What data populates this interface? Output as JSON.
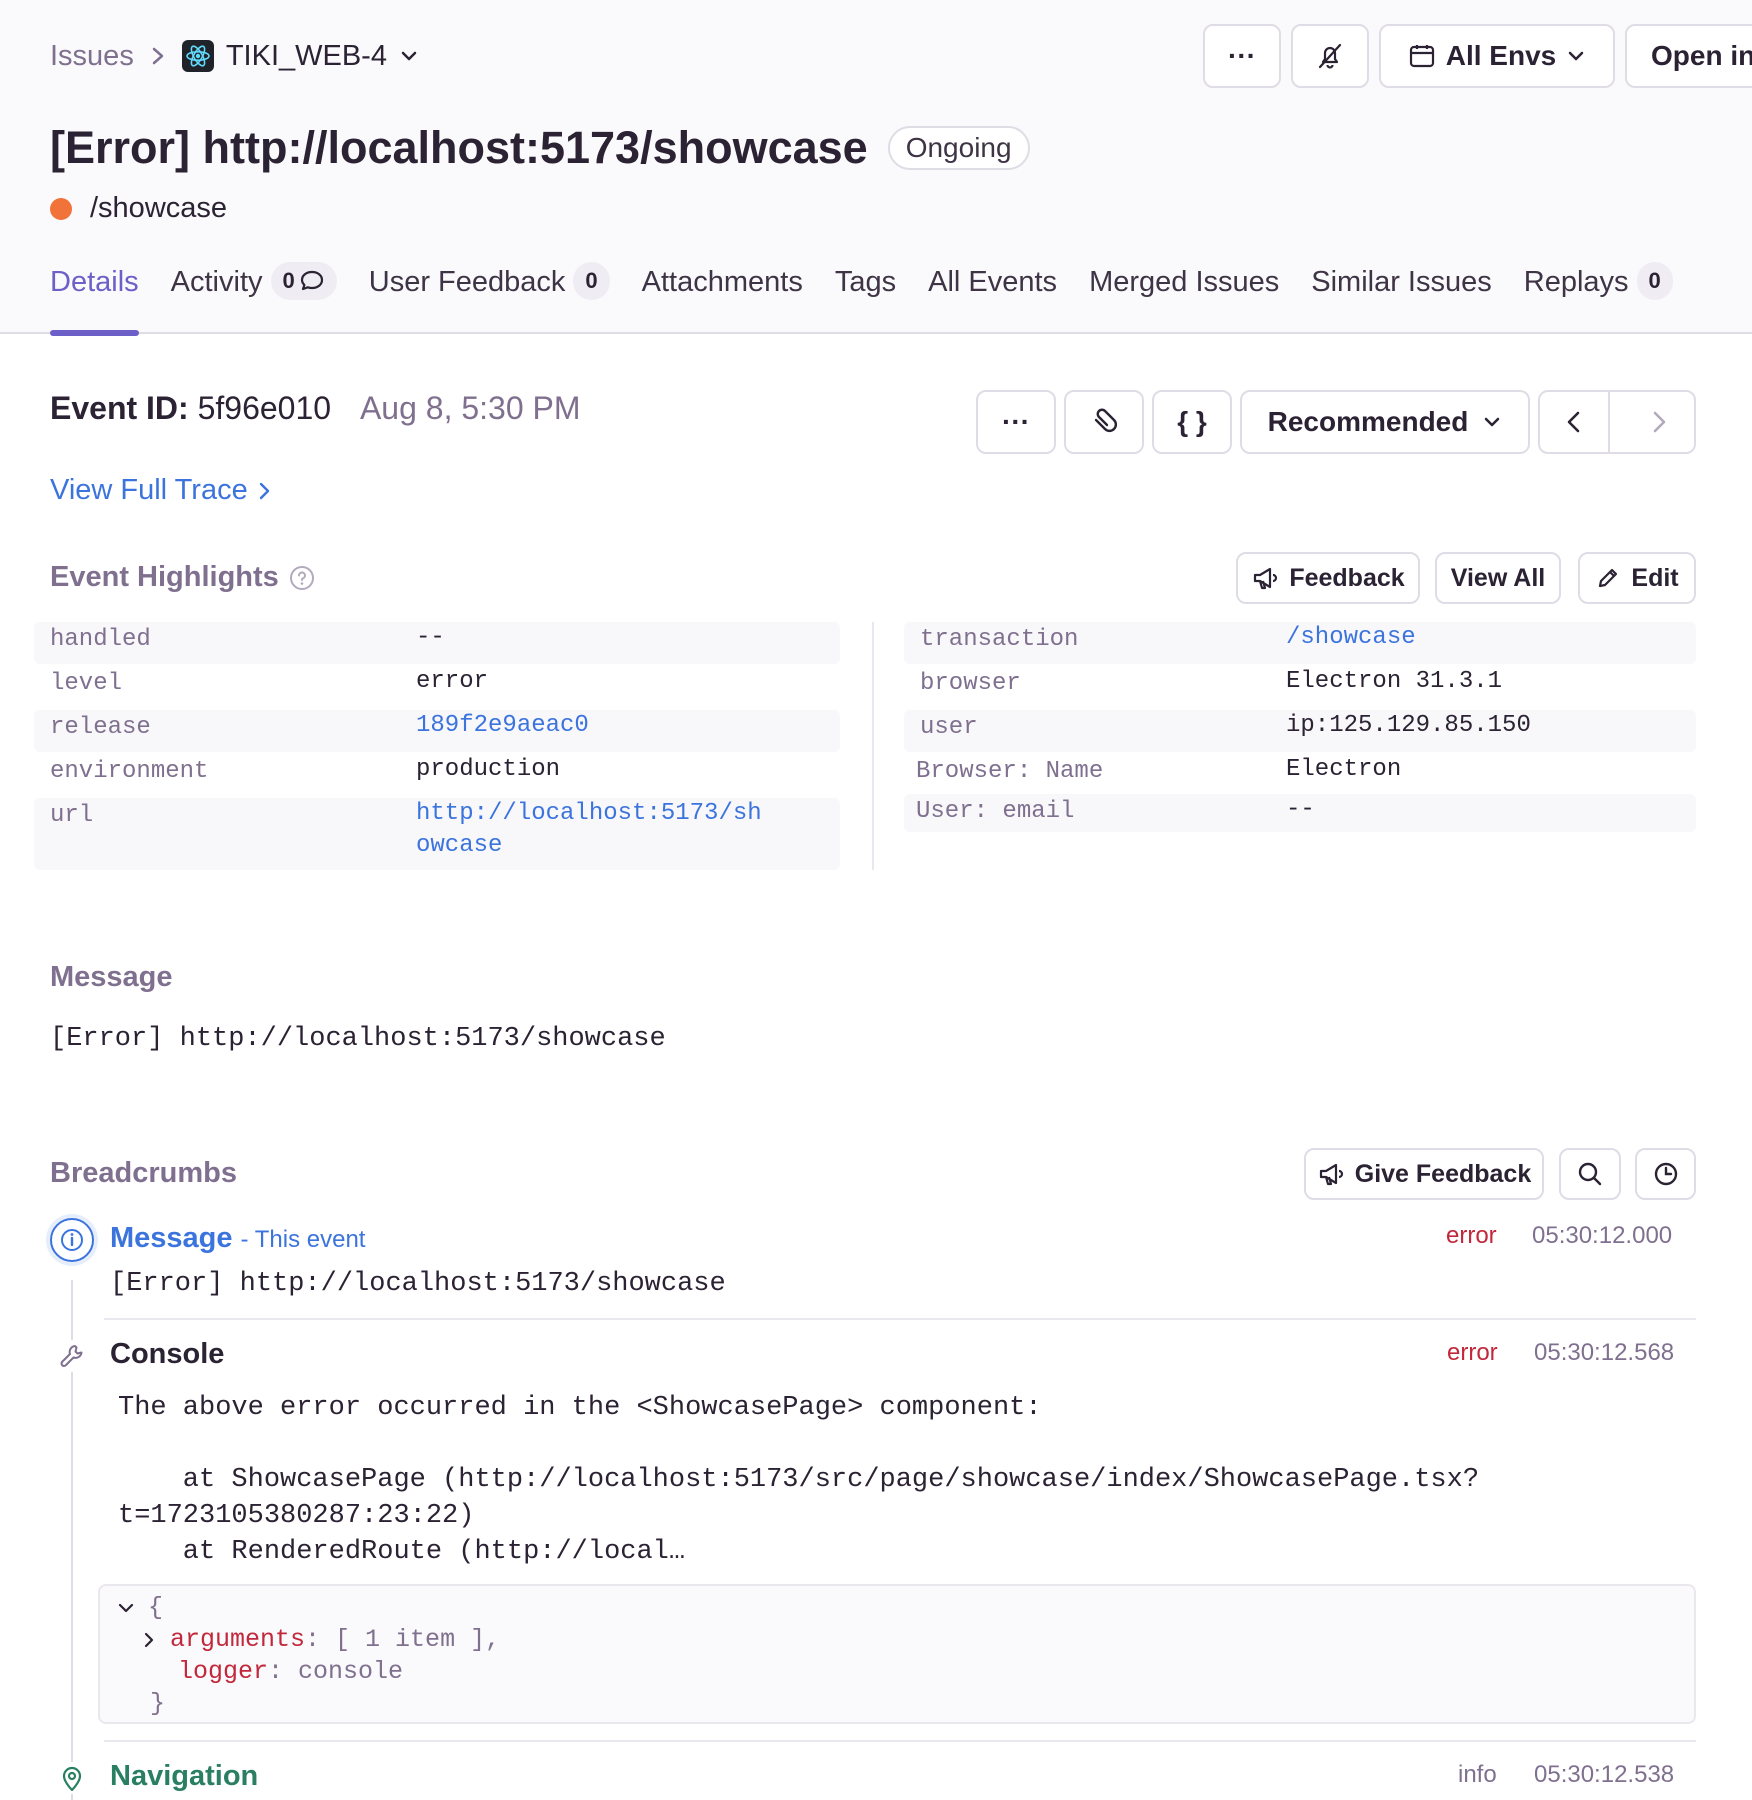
{
  "breadcrumb": {
    "issues": "Issues",
    "project": "TIKI_WEB-4"
  },
  "header_actions": {
    "more": "···",
    "env": "All Envs",
    "open": "Open in"
  },
  "issue": {
    "title": "[Error] http://localhost:5173/showcase",
    "status": "Ongoing",
    "culprit": "/showcase"
  },
  "tabs": [
    {
      "label": "Details"
    },
    {
      "label": "Activity",
      "count": "0"
    },
    {
      "label": "User Feedback",
      "count": "0"
    },
    {
      "label": "Attachments"
    },
    {
      "label": "Tags"
    },
    {
      "label": "All Events"
    },
    {
      "label": "Merged Issues"
    },
    {
      "label": "Similar Issues"
    },
    {
      "label": "Replays",
      "count": "0"
    }
  ],
  "event": {
    "id_label": "Event ID:",
    "id": "5f96e010",
    "date": "Aug 8, 5:30 PM",
    "more": "···",
    "json": "{ }",
    "sort": "Recommended",
    "trace_link": "View Full Trace"
  },
  "highlights": {
    "title": "Event Highlights",
    "feedback": "Feedback",
    "view_all": "View All",
    "edit": "Edit",
    "left": [
      {
        "key": "handled",
        "value": "--"
      },
      {
        "key": "level",
        "value": "error"
      },
      {
        "key": "release",
        "value": "189f2e9aeac0"
      },
      {
        "key": "environment",
        "value": "production"
      },
      {
        "key": "url",
        "value": "http://localhost:5173/sh",
        "value2": "owcase"
      }
    ],
    "right": [
      {
        "key": "transaction",
        "value": "/showcase"
      },
      {
        "key": "browser",
        "value": "Electron 31.3.1"
      },
      {
        "key": "user",
        "value": "ip:125.129.85.150"
      },
      {
        "key": "Browser: Name",
        "value": "Electron"
      },
      {
        "key": "User: email",
        "value": "--"
      }
    ]
  },
  "message": {
    "title": "Message",
    "text": "[Error] http://localhost:5173/showcase"
  },
  "breadcrumbs": {
    "title": "Breadcrumbs",
    "give_feedback": "Give Feedback",
    "items": [
      {
        "category": "Message",
        "suffix": "- This event",
        "level": "error",
        "time": "05:30:12.000",
        "text": "[Error] http://localhost:5173/showcase"
      },
      {
        "category": "Console",
        "level": "error",
        "time": "05:30:12.568",
        "line1": "The above error occurred in the <ShowcasePage> component:",
        "line2": "    at ShowcasePage (http://localhost:5173/src/page/showcase/index/ShowcasePage.tsx?",
        "line3": "t=1723105380287:23:22)",
        "line4": "    at RenderedRoute (http://local…",
        "json_open": "{",
        "json_args_key": "arguments",
        "json_args_val": "[ 1 item ],",
        "json_logger_key": "logger",
        "json_logger_val": "console",
        "json_close": "}"
      },
      {
        "category": "Navigation",
        "level": "info",
        "time": "05:30:12.538"
      }
    ]
  },
  "colors": {
    "accent": "#6c5fc7",
    "link": "#3c74dd",
    "error": "#c2283b",
    "orange": "#f2733a",
    "navigation": "#2a7f62"
  }
}
